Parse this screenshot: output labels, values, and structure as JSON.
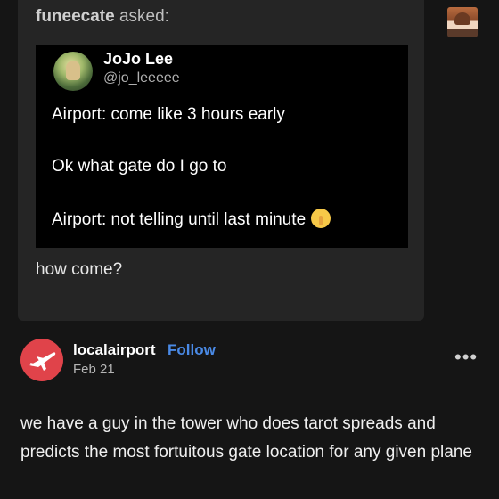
{
  "ask": {
    "asker_name": "funeecate",
    "asked_label": " asked:",
    "question": "how come?"
  },
  "tweet": {
    "name": "JoJo Lee",
    "handle": "@jo_leeeee",
    "lines": [
      "Airport: come like 3 hours early",
      "Ok what gate do I go to",
      "Airport: not telling until last minute"
    ],
    "emoji": "shushing-face-icon"
  },
  "post": {
    "username": "localairport",
    "follow_label": "Follow",
    "date": "Feb 21",
    "more_label": "•••",
    "body": "we have a guy in the tower who does tarot spreads and predicts the most fortuitous gate location for any given plane"
  },
  "colors": {
    "background": "#151515",
    "card": "#252525",
    "follow": "#4a8ae6",
    "airport_avatar": "#e0434a"
  }
}
